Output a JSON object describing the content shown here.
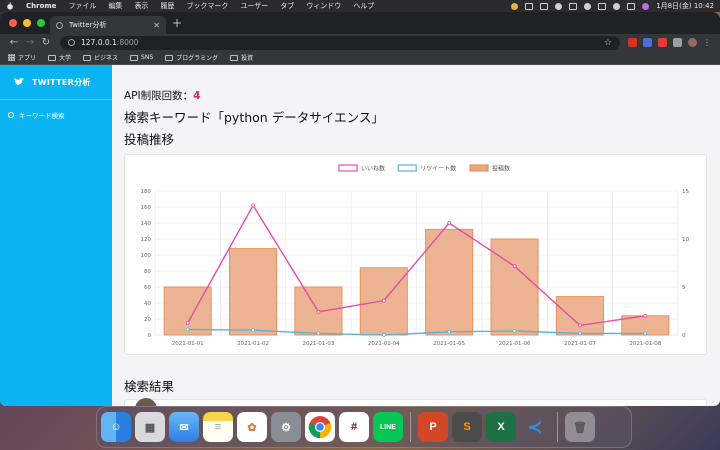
{
  "menubar": {
    "app": "Chrome",
    "items": [
      "ファイル",
      "編集",
      "表示",
      "履歴",
      "ブックマーク",
      "ユーザー",
      "タブ",
      "ウィンドウ",
      "ヘルプ"
    ],
    "datetime": "1月8日(金)  10:42"
  },
  "browser": {
    "tab_title": "Twitter分析",
    "url_host": "127.0.0.1",
    "url_port": ":8000",
    "bookmarks": [
      "アプリ",
      "大学",
      "ビジネス",
      "SNS",
      "プログラミング",
      "投資"
    ]
  },
  "sidebar": {
    "brand": "TWITTER分析",
    "items": [
      {
        "label": "キーワード検索"
      }
    ]
  },
  "main": {
    "api_label": "API制限回数：",
    "api_count": "4",
    "keyword_heading": "検索キーワード「python データサイエンス」",
    "chart_heading": "投稿推移",
    "results_heading": "検索結果"
  },
  "chart_data": {
    "type": "bar",
    "categories": [
      "2021-01-01",
      "2021-01-02",
      "2021-01-03",
      "2021-01-04",
      "2021-01-05",
      "2021-01-06",
      "2021-01-07",
      "2021-01-08"
    ],
    "series": [
      {
        "name": "いいね数",
        "type": "line",
        "axis": "left",
        "color": "#e64ca8",
        "values": [
          15,
          162,
          29,
          43,
          140,
          86,
          12,
          24
        ]
      },
      {
        "name": "リツイート数",
        "type": "line",
        "axis": "left",
        "color": "#5ab4d6",
        "values": [
          7,
          6,
          2,
          0,
          4,
          5,
          2,
          2
        ]
      },
      {
        "name": "投稿数",
        "type": "bar",
        "axis": "right",
        "color": "#e9a77f",
        "values": [
          5,
          9,
          5,
          7,
          11,
          10,
          4,
          2
        ]
      }
    ],
    "y_left": {
      "min": 0,
      "max": 180,
      "ticks": [
        0,
        20,
        40,
        60,
        80,
        100,
        120,
        140,
        160,
        180
      ]
    },
    "y_right": {
      "min": 0,
      "max": 15,
      "ticks": [
        0,
        5,
        10,
        15
      ]
    },
    "legend": "top-center",
    "grid": true
  },
  "dock": {
    "apps": [
      "Finder",
      "Launchpad",
      "Mail",
      "Notes",
      "Photos",
      "System Preferences",
      "Chrome",
      "Slack",
      "LINE",
      "PowerPoint",
      "Sublime Text",
      "Excel",
      "VS Code",
      "Trash"
    ]
  }
}
